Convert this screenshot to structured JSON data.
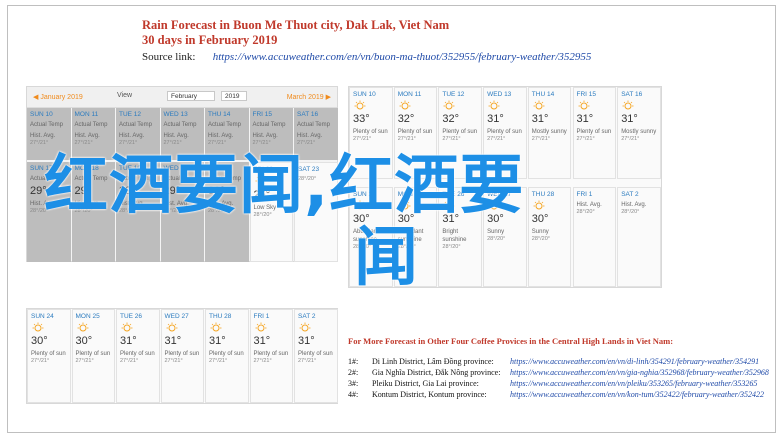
{
  "header": {
    "title": "Rain Forecast in Buon Me Thuot city, Dak Lak, Viet Nam",
    "subtitle": "30 days in February 2019",
    "source_label": "Source link:",
    "source_url": "https://www.accuweather.com/en/vn/buon-ma-thuot/352955/february-weather/352955"
  },
  "calendar_left": {
    "prev_month": "◀ January 2019",
    "view_label": "View",
    "month_select": "February",
    "year_select": "2019",
    "next_month": "March 2019 ▶",
    "row1": [
      {
        "day": "SUN 10",
        "sub": "Actual Temp",
        "temp": "",
        "desc": "Hist. Avg.",
        "lo": "27°/21°"
      },
      {
        "day": "MON 11",
        "sub": "Actual Temp",
        "temp": "",
        "desc": "Hist. Avg.",
        "lo": "27°/21°"
      },
      {
        "day": "TUE 12",
        "sub": "Actual Temp",
        "temp": "",
        "desc": "Hist. Avg.",
        "lo": "27°/21°"
      },
      {
        "day": "WED 13",
        "sub": "Actual Temp",
        "temp": "",
        "desc": "Hist. Avg.",
        "lo": "27°/21°"
      },
      {
        "day": "THU 14",
        "sub": "Actual Temp",
        "temp": "",
        "desc": "Hist. Avg.",
        "lo": "27°/21°"
      },
      {
        "day": "FRI 15",
        "sub": "Actual Temp",
        "temp": "",
        "desc": "Hist. Avg.",
        "lo": "27°/21°"
      },
      {
        "day": "SAT 16",
        "sub": "Actual Temp",
        "temp": "",
        "desc": "Hist. Avg.",
        "lo": "27°/21°"
      }
    ],
    "row2": [
      {
        "day": "SUN 17",
        "sub": "Actual Temp",
        "temp": "29°",
        "desc": "Hist. Avg.",
        "lo": "28°/20°"
      },
      {
        "day": "MON 18",
        "sub": "Actual Temp",
        "temp": "29°",
        "desc": "Hist. Avg.",
        "lo": "28°/20°"
      },
      {
        "day": "TUE 19",
        "sub": "Actual Temp",
        "temp": "29°",
        "desc": "Hist. Avg.",
        "lo": "28°/20°"
      },
      {
        "day": "WED 20",
        "sub": "Actual Temp",
        "temp": "29°",
        "desc": "Hist. Avg.",
        "lo": "28°/20°"
      },
      {
        "day": "THU 21",
        "sub": "Actual Temp",
        "temp": "30°",
        "desc": "Hist. Avg.",
        "lo": "28°/20°"
      },
      {
        "day": "FRI 22",
        "sub": "",
        "temp": "26°",
        "desc": "Low Sky",
        "lo": "28°/20°"
      },
      {
        "day": "SAT 23",
        "sub": "",
        "temp": "",
        "desc": "",
        "lo": "28°/20°"
      }
    ]
  },
  "calendar_right": {
    "row1": [
      {
        "day": "SUN 10",
        "temp": "33°",
        "desc": "Plenty of sun",
        "lo": "27°/21°"
      },
      {
        "day": "MON 11",
        "temp": "32°",
        "desc": "Plenty of sun",
        "lo": "27°/21°"
      },
      {
        "day": "TUE 12",
        "temp": "32°",
        "desc": "Plenty of sun",
        "lo": "27°/21°"
      },
      {
        "day": "WED 13",
        "temp": "31°",
        "desc": "Plenty of sun",
        "lo": "27°/21°"
      },
      {
        "day": "THU 14",
        "temp": "31°",
        "desc": "Mostly sunny",
        "lo": "27°/21°"
      },
      {
        "day": "FRI 15",
        "temp": "31°",
        "desc": "Plenty of sun",
        "lo": "27°/21°"
      },
      {
        "day": "SAT 16",
        "temp": "31°",
        "desc": "Mostly sunny",
        "lo": "27°/21°"
      }
    ],
    "row2": [
      {
        "day": "SUN 24",
        "temp": "30°",
        "desc": "Abundant sunshine",
        "lo": "28°/20°"
      },
      {
        "day": "MON 25",
        "temp": "30°",
        "desc": "Abundant sunshine",
        "lo": "28°/20°"
      },
      {
        "day": "TUE 26",
        "temp": "31°",
        "desc": "Bright sunshine",
        "lo": "28°/20°"
      },
      {
        "day": "WED 27",
        "temp": "30°",
        "desc": "Sunny",
        "lo": "28°/20°"
      },
      {
        "day": "THU 28",
        "temp": "30°",
        "desc": "Sunny",
        "lo": "28°/20°"
      },
      {
        "day": "FRI 1",
        "temp": "",
        "desc": "Hist. Avg.",
        "lo": "28°/20°"
      },
      {
        "day": "SAT 2",
        "temp": "",
        "desc": "Hist. Avg.",
        "lo": "28°/20°"
      }
    ]
  },
  "calendar_bottom": {
    "row": [
      {
        "day": "SUN 24",
        "temp": "30°",
        "desc": "Plenty of sun",
        "lo": "27°/21°"
      },
      {
        "day": "MON 25",
        "temp": "30°",
        "desc": "Plenty of sun",
        "lo": "27°/21°"
      },
      {
        "day": "TUE 26",
        "temp": "31°",
        "desc": "Plenty of sun",
        "lo": "27°/21°"
      },
      {
        "day": "WED 27",
        "temp": "31°",
        "desc": "Plenty of sun",
        "lo": "27°/21°"
      },
      {
        "day": "THU 28",
        "temp": "31°",
        "desc": "Plenty of sun",
        "lo": "27°/21°"
      },
      {
        "day": "FRI 1",
        "temp": "31°",
        "desc": "Plenty of sun",
        "lo": "27°/21°"
      },
      {
        "day": "SAT 2",
        "temp": "31°",
        "desc": "Plenty of sun",
        "lo": "27°/21°"
      }
    ]
  },
  "more_forecast": {
    "heading": "For More Forecast in Other Four Coffee Provices in the Central High Lands in Viet Nam:",
    "items": [
      {
        "n": "1#:",
        "name": "Di Linh District, Lâm Đồng province:",
        "url": "https://www.accuweather.com/en/vn/di-linh/354291/february-weather/354291"
      },
      {
        "n": "2#:",
        "name": "Gia Nghĩa District, Đắk Nông province:",
        "url": "https://www.accuweather.com/en/vn/gia-nghia/352968/february-weather/352968"
      },
      {
        "n": "3#:",
        "name": "Pleiku District, Gia Lai province:",
        "url": "https://www.accuweather.com/en/vn/pleiku/353265/february-weather/353265"
      },
      {
        "n": "4#:",
        "name": "Kontum District, Kontum province:",
        "url": "https://www.accuweather.com/en/vn/kon-tum/352422/february-weather/352422"
      }
    ]
  },
  "overlay": {
    "line1": "红酒要闻,红酒要",
    "line2": "闻"
  },
  "colors": {
    "accent_red": "#c0392b",
    "link_blue": "#1f4aa8",
    "overlay_blue": "#1d8fe6",
    "sun_orange": "#f5a623"
  }
}
